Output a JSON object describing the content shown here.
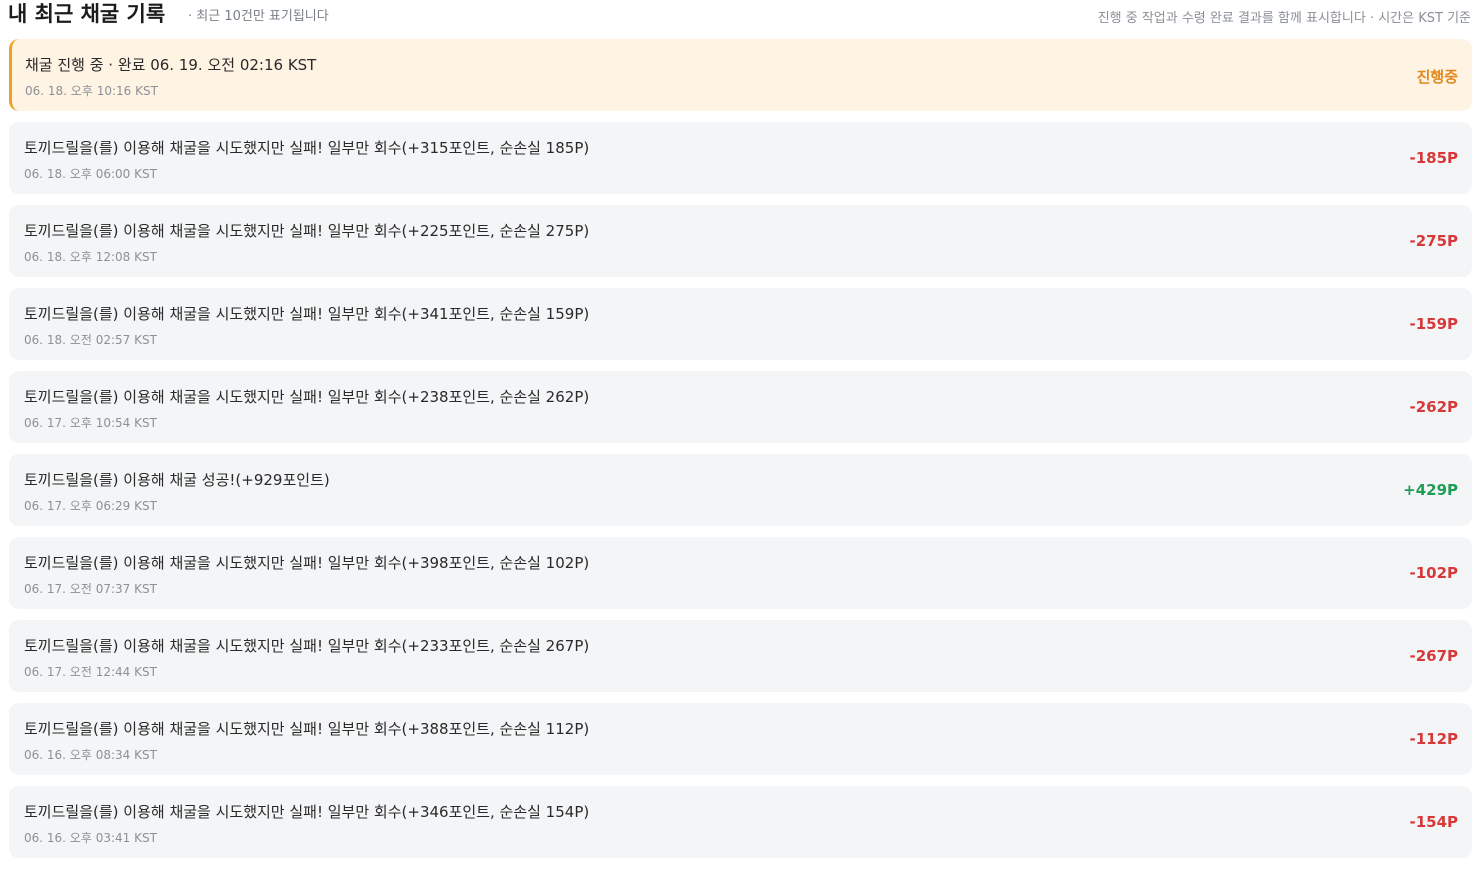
{
  "header": {
    "title": "내 최근 채굴 기록",
    "subtitle": "· 최근 10건만 표기됩니다",
    "note": "진행 중 작업과 수령 완료 결과를 함께 표시합니다 · 시간은 KST 기준"
  },
  "colors": {
    "pending_bg": "#fff3e3",
    "pending_accent": "#f0a020",
    "loss": "#d63939",
    "gain": "#1f9d55",
    "pending_text": "#e08a1e"
  },
  "records": [
    {
      "message": "채굴 진행 중 · 완료 06. 19. 오전 02:16 KST",
      "time": "06. 18. 오후 10:16 KST",
      "amount": "진행중",
      "status": "pending"
    },
    {
      "message": "토끼드릴을(를) 이용해 채굴을 시도했지만 실패! 일부만 회수(+315포인트, 순손실 185P)",
      "time": "06. 18. 오후 06:00 KST",
      "amount": "-185P",
      "status": "loss"
    },
    {
      "message": "토끼드릴을(를) 이용해 채굴을 시도했지만 실패! 일부만 회수(+225포인트, 순손실 275P)",
      "time": "06. 18. 오후 12:08 KST",
      "amount": "-275P",
      "status": "loss"
    },
    {
      "message": "토끼드릴을(를) 이용해 채굴을 시도했지만 실패! 일부만 회수(+341포인트, 순손실 159P)",
      "time": "06. 18. 오전 02:57 KST",
      "amount": "-159P",
      "status": "loss"
    },
    {
      "message": "토끼드릴을(를) 이용해 채굴을 시도했지만 실패! 일부만 회수(+238포인트, 순손실 262P)",
      "time": "06. 17. 오후 10:54 KST",
      "amount": "-262P",
      "status": "loss"
    },
    {
      "message": "토끼드릴을(를) 이용해 채굴 성공!(+929포인트)",
      "time": "06. 17. 오후 06:29 KST",
      "amount": "+429P",
      "status": "gain"
    },
    {
      "message": "토끼드릴을(를) 이용해 채굴을 시도했지만 실패! 일부만 회수(+398포인트, 순손실 102P)",
      "time": "06. 17. 오전 07:37 KST",
      "amount": "-102P",
      "status": "loss"
    },
    {
      "message": "토끼드릴을(를) 이용해 채굴을 시도했지만 실패! 일부만 회수(+233포인트, 순손실 267P)",
      "time": "06. 17. 오전 12:44 KST",
      "amount": "-267P",
      "status": "loss"
    },
    {
      "message": "토끼드릴을(를) 이용해 채굴을 시도했지만 실패! 일부만 회수(+388포인트, 순손실 112P)",
      "time": "06. 16. 오후 08:34 KST",
      "amount": "-112P",
      "status": "loss"
    },
    {
      "message": "토끼드릴을(를) 이용해 채굴을 시도했지만 실패! 일부만 회수(+346포인트, 순손실 154P)",
      "time": "06. 16. 오후 03:41 KST",
      "amount": "-154P",
      "status": "loss"
    }
  ]
}
